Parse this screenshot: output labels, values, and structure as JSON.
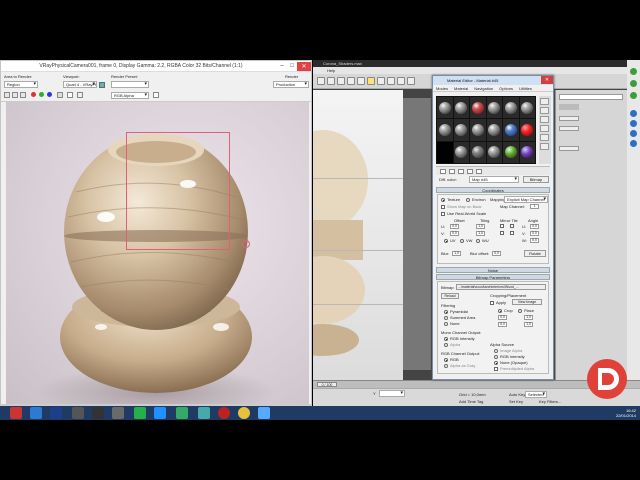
{
  "frame_window": {
    "title": "VRayPhysicalCamera001, frame 0, Display Gamma: 2.2, RGBA Color 32 Bits/Channel (1:1)",
    "area_to_render_label": "Area to Render:",
    "area_to_render_value": "Region",
    "viewport_label": "Viewport:",
    "viewport_value": "Quad 4 - VRayPh",
    "render_preset_label": "Render Preset:",
    "render_preset_value": "",
    "render_label": "Render",
    "render_value": "Production",
    "channel_value": "RGB Alpha"
  },
  "max_window": {
    "title": "Corona_Shaders.max",
    "menu": "Help",
    "axis_label": "Y",
    "timeline_range": "0 / 100",
    "grid_value": "Grid = 10,0mm",
    "auto_key": "Auto Key",
    "selected": "Selected",
    "set_key": "Set Key",
    "key_filters": "Key Filters...",
    "add_time_tag": "Add Time Tag"
  },
  "material_editor": {
    "title": "Material Editor - Material #45",
    "menu": [
      "Modes",
      "Material",
      "Navigation",
      "Options",
      "Utilities"
    ],
    "map_label": "Diff. color:",
    "map_name": "Map #45",
    "map_type": "Bitmap",
    "coordinates_rollout": "Coordinates",
    "texture_radio": "Texture",
    "environ_radio": "Environ",
    "mapping_label": "Mapping:",
    "mapping_value": "Explicit Map Channel",
    "show_map_on_back": "Show Map on Back",
    "map_channel_label": "Map Channel:",
    "map_channel_value": "1",
    "use_real_world": "Use Real-World Scale",
    "offset_label": "Offset",
    "tiling_label": "Tiling",
    "mirror_tile_label": "Mirror Tile",
    "angle_label": "Angle",
    "u_label": "U:",
    "v_label": "V:",
    "w_label": "W:",
    "u_offset": "0,0",
    "v_offset": "0,0",
    "u_tiling": "1,0",
    "v_tiling": "1,0",
    "u_angle": "0,0",
    "v_angle": "0,0",
    "w_angle": "0,0",
    "uv": "UV",
    "vw": "VW",
    "wu": "WU",
    "rotate_button": "Rotate",
    "blur_label": "Blur:",
    "blur_value": "1,0",
    "blur_offset_label": "Blur offset:",
    "blur_offset_value": "0,0",
    "noise_rollout": "Noise",
    "bitmap_params_rollout": "Bitmap Parameters",
    "bitmap_label": "Bitmap:",
    "bitmap_path": "...\\material\\wood\\archinteriors\\Wood_...",
    "reload_button": "Reload",
    "cropping_label": "Cropping/Placement",
    "apply_label": "Apply",
    "view_image_button": "View Image",
    "crop_radio": "Crop",
    "place_radio": "Place",
    "u_crop": "0,0",
    "v_crop": "0,0",
    "w_crop": "1,0",
    "h_crop": "1,0",
    "filtering_label": "Filtering",
    "pyramidal": "Pyramidal",
    "summed_area": "Summed Area",
    "none": "None",
    "mono_output_label": "Mono Channel Output:",
    "rgb_intensity": "RGB Intensity",
    "alpha": "Alpha",
    "rgb_output_label": "RGB Channel Output:",
    "rgb": "RGB",
    "alpha_as_gray": "Alpha as Gray",
    "alpha_source_label": "Alpha Source",
    "image_alpha": "Image Alpha",
    "rgb_intensity2": "RGB Intensity",
    "none_opaque": "None (Opaque)",
    "premult_alpha": "Premultiplied Alpha"
  },
  "taskbar": {
    "time": "16:42",
    "date": "22/01/2014"
  },
  "colors": {
    "taskbar": "#1f3b63",
    "selection_box": "#e0607a",
    "logo": "#e0423a"
  }
}
